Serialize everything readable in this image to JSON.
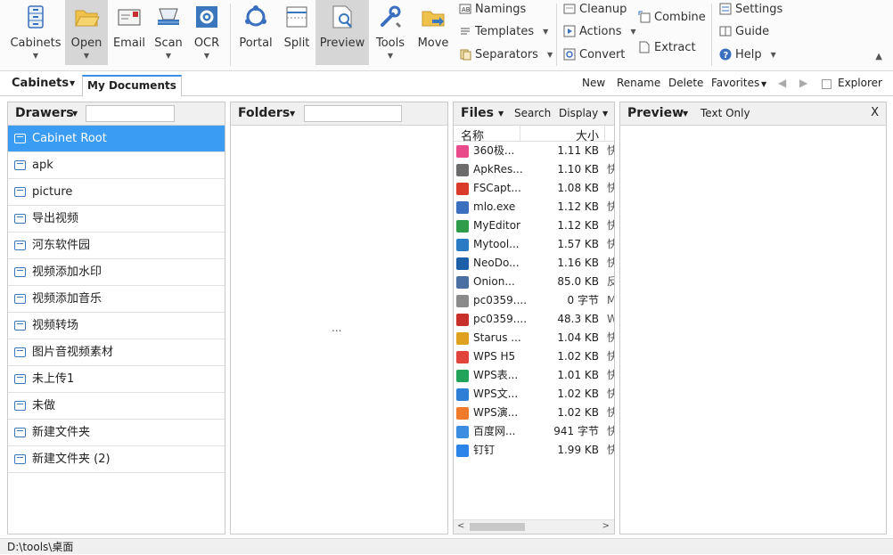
{
  "ribbon": {
    "big_buttons": [
      {
        "label": "Cabinets",
        "icon": "cabinet-icon"
      },
      {
        "label": "Open",
        "icon": "folder-open-icon"
      },
      {
        "label": "Email",
        "icon": "email-icon"
      },
      {
        "label": "Scan",
        "icon": "scanner-icon"
      },
      {
        "label": "OCR",
        "icon": "ocr-icon"
      },
      {
        "label": "Portal",
        "icon": "portal-icon"
      },
      {
        "label": "Split",
        "icon": "split-icon"
      },
      {
        "label": "Preview",
        "icon": "preview-icon"
      },
      {
        "label": "Tools",
        "icon": "tools-icon"
      },
      {
        "label": "Move",
        "icon": "move-icon"
      }
    ],
    "naming": {
      "namings": "Namings",
      "templates": "Templates",
      "separators": "Separators"
    },
    "clean": {
      "cleanup": "Cleanup",
      "actions": "Actions",
      "convert": "Convert",
      "combine": "Combine",
      "extract": "Extract"
    },
    "help": {
      "settings": "Settings",
      "guide": "Guide",
      "help": "Help"
    }
  },
  "tabbar": {
    "cabinets_label": "Cabinets",
    "active_tab": "My Documents",
    "new": "New",
    "rename": "Rename",
    "delete": "Delete",
    "favorites": "Favorites",
    "explorer": "Explorer"
  },
  "drawers": {
    "title": "Drawers",
    "items": [
      "Cabinet Root",
      "apk",
      "picture",
      "导出视频",
      "河东软件园",
      "视频添加水印",
      "视频添加音乐",
      "视频转场",
      "图片音视频素材",
      "未上传1",
      "未做",
      "新建文件夹",
      "新建文件夹 (2)"
    ]
  },
  "folders": {
    "title": "Folders",
    "placeholder_dots": "..."
  },
  "files": {
    "title": "Files",
    "search": "Search",
    "display": "Display",
    "col_name": "名称",
    "col_size": "大小",
    "items": [
      {
        "name": "360极...",
        "size": "1.11 KB",
        "type": "快",
        "color": "#e84a8a"
      },
      {
        "name": "ApkRes...",
        "size": "1.10 KB",
        "type": "快",
        "color": "#6b6b6b"
      },
      {
        "name": "FSCapt...",
        "size": "1.08 KB",
        "type": "快",
        "color": "#d93a2a"
      },
      {
        "name": "mlo.exe",
        "size": "1.12 KB",
        "type": "快",
        "color": "#3a6fbf"
      },
      {
        "name": "MyEditor",
        "size": "1.12 KB",
        "type": "快",
        "color": "#2f9c4a"
      },
      {
        "name": "Mytool...",
        "size": "1.57 KB",
        "type": "快",
        "color": "#2a7bc4"
      },
      {
        "name": "NeoDo...",
        "size": "1.16 KB",
        "type": "快",
        "color": "#1f5fa8"
      },
      {
        "name": "Onion...",
        "size": "85.0 KB",
        "type": "反",
        "color": "#4a6fa0"
      },
      {
        "name": "pc0359....",
        "size": "0 字节",
        "type": "M",
        "color": "#8a8a8a"
      },
      {
        "name": "pc0359....",
        "size": "48.3 KB",
        "type": "W",
        "color": "#c9302c"
      },
      {
        "name": "Starus ...",
        "size": "1.04 KB",
        "type": "快",
        "color": "#e0a020"
      },
      {
        "name": "WPS H5",
        "size": "1.02 KB",
        "type": "快",
        "color": "#e0443a"
      },
      {
        "name": "WPS表...",
        "size": "1.01 KB",
        "type": "快",
        "color": "#21a45a"
      },
      {
        "name": "WPS文...",
        "size": "1.02 KB",
        "type": "快",
        "color": "#2f7fd6"
      },
      {
        "name": "WPS演...",
        "size": "1.02 KB",
        "type": "快",
        "color": "#ef7a2a"
      },
      {
        "name": "百度网...",
        "size": "941 字节",
        "type": "快",
        "color": "#3a8de0"
      },
      {
        "name": "钉钉",
        "size": "1.99 KB",
        "type": "快",
        "color": "#2b84e8"
      }
    ]
  },
  "preview": {
    "title": "Preview",
    "mode": "Text Only",
    "close": "X"
  },
  "status": {
    "path": "D:\\tools\\桌面"
  },
  "colors": {
    "accent": "#3b9cf4",
    "active_tab_border": "#3b8ee4"
  }
}
